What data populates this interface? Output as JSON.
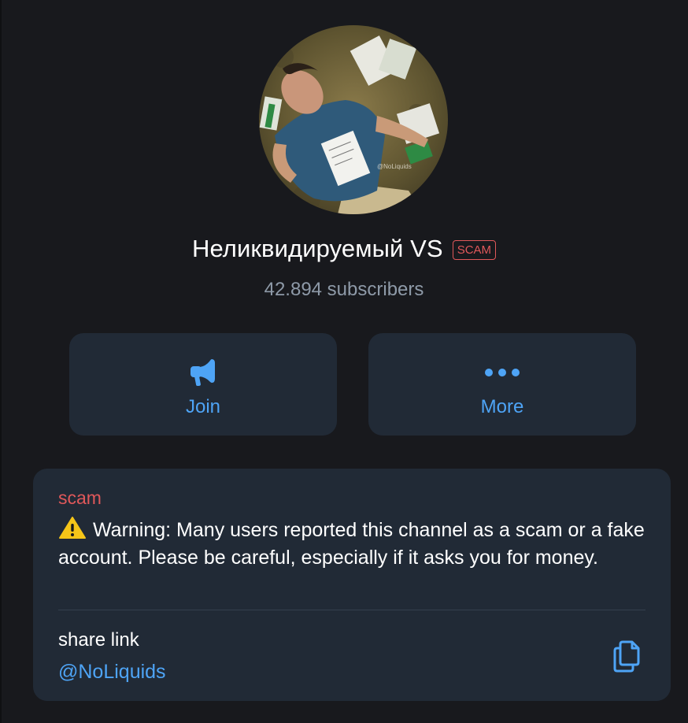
{
  "channel": {
    "title": "Неликвидируемый VS",
    "badge": "SCAM",
    "subscribers": "42.894 subscribers",
    "avatar_watermark": "@NoLiquids"
  },
  "actions": {
    "join_label": "Join",
    "join_icon": "megaphone-icon",
    "more_label": "More",
    "more_icon": "ellipsis-icon"
  },
  "info": {
    "scam_heading": "scam",
    "warning_emoji": "⚠️",
    "warning_text": "Warning: Many users reported this channel as a scam or a fake account. Please be careful, especially if it asks you for money.",
    "share_label": "share link",
    "share_handle": "@NoLiquids",
    "copy_icon": "copy-icon"
  },
  "colors": {
    "background": "#18191d",
    "card": "#212a36",
    "accent": "#4ea4f6",
    "scam": "#e0585a",
    "muted": "#8e9aa8"
  }
}
